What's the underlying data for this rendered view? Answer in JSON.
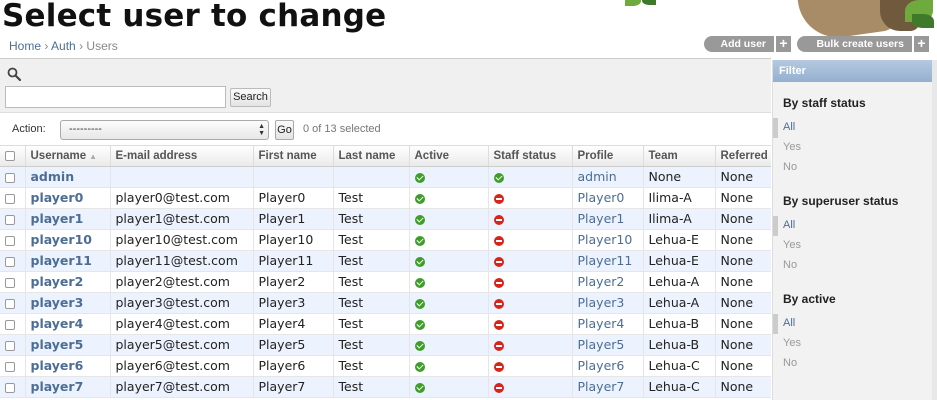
{
  "page_title": "Select user to change",
  "breadcrumbs": [
    {
      "label": "Home"
    },
    {
      "label": "Auth"
    },
    {
      "label": "Users"
    }
  ],
  "breadcrumb_separator": "›",
  "object_tools": {
    "add_user": "Add user",
    "bulk_create": "Bulk create users",
    "plus": "+"
  },
  "search": {
    "value": "",
    "button": "Search"
  },
  "actions": {
    "label": "Action:",
    "selected_option": "---------",
    "go": "Go",
    "count_text": "0 of 13 selected"
  },
  "table": {
    "columns": [
      "Username",
      "E-mail address",
      "First name",
      "Last name",
      "Active",
      "Staff status",
      "Profile",
      "Team",
      "Referred by"
    ],
    "rows": [
      {
        "username": "admin",
        "email": "",
        "first": "",
        "last": "",
        "active": true,
        "staff": true,
        "profile": "admin",
        "team": "None",
        "referred": "None"
      },
      {
        "username": "player0",
        "email": "player0@test.com",
        "first": "Player0",
        "last": "Test",
        "active": true,
        "staff": false,
        "profile": "Player0",
        "team": "Ilima-A",
        "referred": "None"
      },
      {
        "username": "player1",
        "email": "player1@test.com",
        "first": "Player1",
        "last": "Test",
        "active": true,
        "staff": false,
        "profile": "Player1",
        "team": "Ilima-A",
        "referred": "None"
      },
      {
        "username": "player10",
        "email": "player10@test.com",
        "first": "Player10",
        "last": "Test",
        "active": true,
        "staff": false,
        "profile": "Player10",
        "team": "Lehua-E",
        "referred": "None"
      },
      {
        "username": "player11",
        "email": "player11@test.com",
        "first": "Player11",
        "last": "Test",
        "active": true,
        "staff": false,
        "profile": "Player11",
        "team": "Lehua-E",
        "referred": "None"
      },
      {
        "username": "player2",
        "email": "player2@test.com",
        "first": "Player2",
        "last": "Test",
        "active": true,
        "staff": false,
        "profile": "Player2",
        "team": "Lehua-A",
        "referred": "None"
      },
      {
        "username": "player3",
        "email": "player3@test.com",
        "first": "Player3",
        "last": "Test",
        "active": true,
        "staff": false,
        "profile": "Player3",
        "team": "Lehua-A",
        "referred": "None"
      },
      {
        "username": "player4",
        "email": "player4@test.com",
        "first": "Player4",
        "last": "Test",
        "active": true,
        "staff": false,
        "profile": "Player4",
        "team": "Lehua-B",
        "referred": "None"
      },
      {
        "username": "player5",
        "email": "player5@test.com",
        "first": "Player5",
        "last": "Test",
        "active": true,
        "staff": false,
        "profile": "Player5",
        "team": "Lehua-B",
        "referred": "None"
      },
      {
        "username": "player6",
        "email": "player6@test.com",
        "first": "Player6",
        "last": "Test",
        "active": true,
        "staff": false,
        "profile": "Player6",
        "team": "Lehua-C",
        "referred": "None"
      },
      {
        "username": "player7",
        "email": "player7@test.com",
        "first": "Player7",
        "last": "Test",
        "active": true,
        "staff": false,
        "profile": "Player7",
        "team": "Lehua-C",
        "referred": "None"
      }
    ]
  },
  "filter": {
    "title": "Filter",
    "groups": [
      {
        "heading": "By staff status",
        "options": [
          "All",
          "Yes",
          "No"
        ],
        "selected": "All"
      },
      {
        "heading": "By superuser status",
        "options": [
          "All",
          "Yes",
          "No"
        ],
        "selected": "All"
      },
      {
        "heading": "By active",
        "options": [
          "All",
          "Yes",
          "No"
        ],
        "selected": "All"
      }
    ]
  },
  "icons": {
    "search": "magnifier-icon",
    "true": "checkmark-icon",
    "false": "no-entry-icon",
    "sort": "sort-ascending-icon"
  },
  "colors": {
    "link": "#4c6e95",
    "yes": "#3d9e28",
    "no": "#d9241c",
    "filter_header": "#9fb8d5",
    "row_alt": "#edf3fe"
  }
}
